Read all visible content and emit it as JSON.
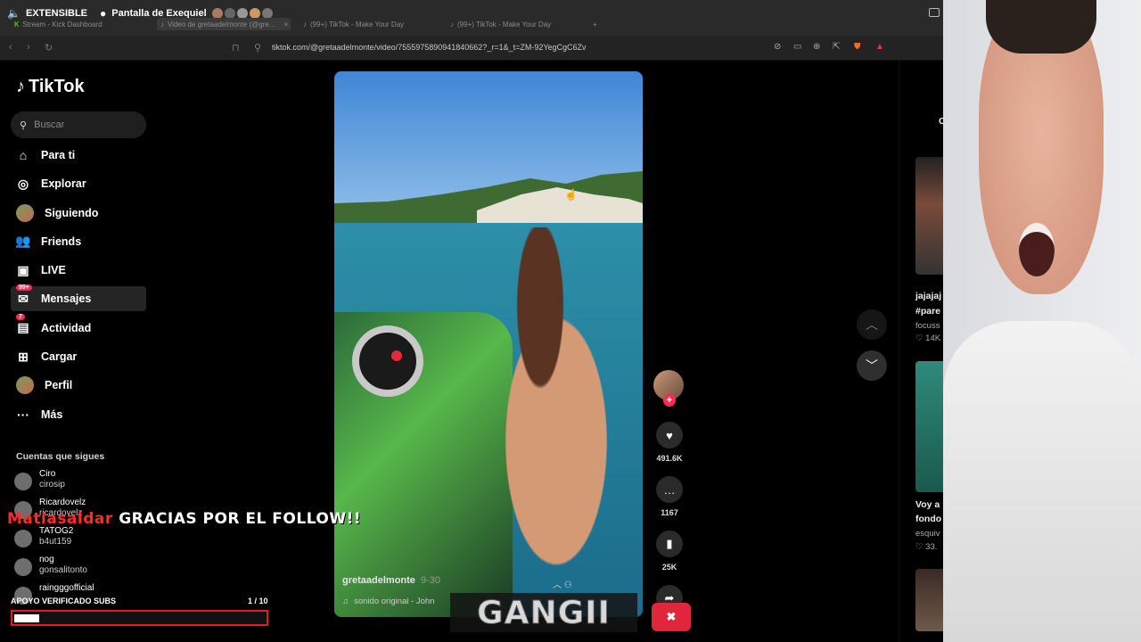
{
  "stream": {
    "extensible": "EXTENSIBLE",
    "screen_name": "Pantalla de Exequiel"
  },
  "browser": {
    "tabs": [
      {
        "label": "Stream - Kick Dashboard"
      },
      {
        "label": "Video de gretaadelmonte (@gre..."
      },
      {
        "label": "(99+) TikTok - Make Your Day"
      },
      {
        "label": "(99+) TikTok - Make Your Day"
      }
    ],
    "url": "tiktok.com/@gretaadelmonte/video/7555975890941840662?_r=1&_t=ZM-92YegCgC6Zv"
  },
  "tiktok": {
    "logo": "TikTok",
    "search_placeholder": "Buscar",
    "nav": [
      {
        "label": "Para ti",
        "icon": "home-icon",
        "glyph": "⌂"
      },
      {
        "label": "Explorar",
        "icon": "compass-icon",
        "glyph": "◎"
      },
      {
        "label": "Siguiendo",
        "icon": "following-avatar",
        "glyph": ""
      },
      {
        "label": "Friends",
        "icon": "friends-icon",
        "glyph": "👥"
      },
      {
        "label": "LIVE",
        "icon": "live-icon",
        "glyph": "▣"
      },
      {
        "label": "Mensajes",
        "icon": "messages-icon",
        "glyph": "✉",
        "badge": "99+"
      },
      {
        "label": "Actividad",
        "icon": "activity-icon",
        "glyph": "▤",
        "badge": "7"
      },
      {
        "label": "Cargar",
        "icon": "upload-icon",
        "glyph": "⊞"
      },
      {
        "label": "Perfil",
        "icon": "profile-avatar",
        "glyph": ""
      },
      {
        "label": "Más",
        "icon": "more-icon",
        "glyph": "···"
      }
    ],
    "following_title": "Cuentas que sigues",
    "following": [
      {
        "name": "Ciro",
        "handle": "cirosip"
      },
      {
        "name": "Ricardovelz",
        "handle": "ricardovelz"
      },
      {
        "name": "TATOG2",
        "handle": "b4ut159"
      },
      {
        "name": "nog",
        "handle": "gonsalitonto"
      },
      {
        "name": "raingggofficial",
        "handle": ""
      }
    ],
    "video": {
      "username": "gretaadelmonte",
      "date": "9-30",
      "sound": "sonido original - John"
    },
    "actions": {
      "likes": "491.6K",
      "comments": "1167",
      "saves": "25K"
    },
    "right_column": [
      {
        "title": "jajajaj",
        "subtitle": "#pare",
        "author": "focuss",
        "likes": "14K"
      },
      {
        "title": "Voy a",
        "subtitle": "fondo",
        "author": "esquiv",
        "likes": "33."
      }
    ],
    "right_header": "C"
  },
  "overlay": {
    "follower_name": "Matiasaldar",
    "follow_message": "GRACIAS POR EL FOLLOW!!",
    "subs_label": "APOYO VERIFICADO SUBS",
    "subs_count": "1 / 10",
    "subs_progress": 0.1,
    "gang_text": "GANGII"
  }
}
